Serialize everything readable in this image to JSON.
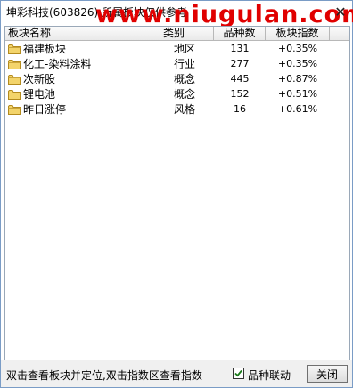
{
  "window": {
    "title": "坤彩科技(603826) 所属板块仅供参考",
    "watermark": "www.niugulan.com",
    "close_symbol": "✕"
  },
  "table": {
    "columns": [
      "板块名称",
      "类别",
      "品种数",
      "板块指数"
    ],
    "rows": [
      {
        "name": "福建板块",
        "category": "地区",
        "count": "131",
        "change": "+0.35%"
      },
      {
        "name": "化工-染料涂料",
        "category": "行业",
        "count": "277",
        "change": "+0.35%"
      },
      {
        "name": "次新股",
        "category": "概念",
        "count": "445",
        "change": "+0.87%"
      },
      {
        "name": "锂电池",
        "category": "概念",
        "count": "152",
        "change": "+0.51%"
      },
      {
        "name": "昨日涨停",
        "category": "风格",
        "count": "16",
        "change": "+0.61%"
      }
    ]
  },
  "footer": {
    "hint": "双击查看板块并定位,双击指数区查看指数",
    "checkbox_label": "品种联动",
    "checkbox_checked": true,
    "close_label": "关闭"
  },
  "icons": {
    "folder": "folder-icon",
    "check": "check-icon"
  }
}
